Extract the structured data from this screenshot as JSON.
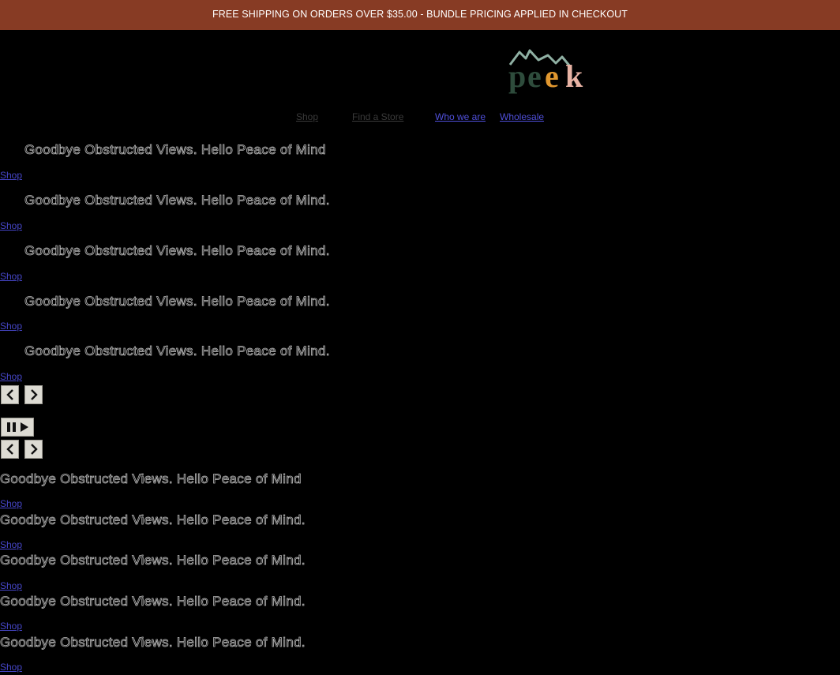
{
  "banner": {
    "text": "FREE SHIPPING ON ORDERS OVER $35.00 - BUNDLE PRICING APPLIED IN CHECKOUT",
    "background": "#873b24"
  },
  "logo": {
    "text": "peek",
    "colors": [
      "#2e4c3c",
      "#e0972f",
      "#e8b3a4",
      "#8fb0a3"
    ]
  },
  "nav": {
    "items": [
      {
        "label": "Shop"
      },
      {
        "label": "Find a Store"
      },
      {
        "label": "Who we are"
      },
      {
        "label": "Wholesale"
      }
    ]
  },
  "slideshow_primary": {
    "slides": [
      {
        "title": "Goodbye Obstructed Views. Hello Peace of Mind",
        "link": "Shop"
      },
      {
        "title": "Goodbye Obstructed Views. Hello Peace of Mind.",
        "link": "Shop"
      },
      {
        "title": "Goodbye Obstructed Views. Hello Peace of Mind.",
        "link": "Shop"
      },
      {
        "title": "Goodbye Obstructed Views. Hello Peace of Mind.",
        "link": "Shop"
      },
      {
        "title": "Goodbye Obstructed Views. Hello Peace of Mind.",
        "link": "Shop"
      }
    ],
    "controls": {
      "prev_icon": "chevron-left-icon",
      "next_icon": "chevron-right-icon",
      "playpause_icon": "pause-play-icon"
    }
  },
  "slideshow_secondary": {
    "slides": [
      {
        "title": "Goodbye Obstructed Views. Hello Peace of Mind",
        "link": "Shop"
      },
      {
        "title": "Goodbye Obstructed Views. Hello Peace of Mind.",
        "link": "Shop"
      },
      {
        "title": "Goodbye Obstructed Views. Hello Peace of Mind.",
        "link": "Shop"
      },
      {
        "title": "Goodbye Obstructed Views. Hello Peace of Mind.",
        "link": "Shop"
      },
      {
        "title": "Goodbye Obstructed Views. Hello Peace of Mind.",
        "link": "Shop"
      }
    ],
    "controls": {
      "prev_icon": "chevron-left-icon",
      "next_icon": "chevron-right-icon"
    }
  }
}
